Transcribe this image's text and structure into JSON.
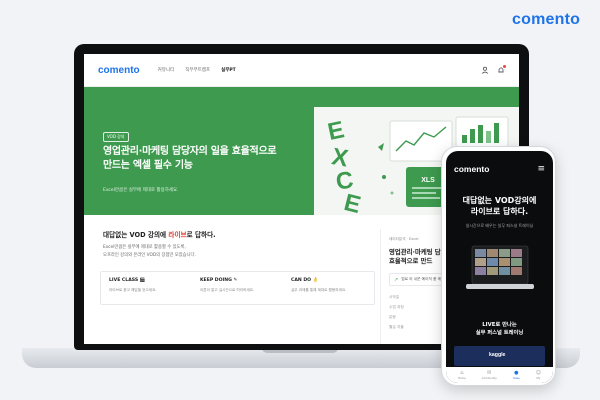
{
  "brand": "comento",
  "site": {
    "logo": "comento",
    "nav": [
      "커뮤니티",
      "직무부트캠프",
      "실무PT"
    ],
    "active_nav_index": 2,
    "icons": [
      "user-icon",
      "bell-icon"
    ]
  },
  "hero": {
    "badge": "VOD 강의",
    "title_line1": "영업관리·마케팅 담당자의 일을 효율적으로",
    "title_line2": "만드는 엑셀 필수 기능",
    "subtitle": "Excel만큼은 실무에 제대로 활용하세요.",
    "art_label": "EXCEL",
    "art_card_label": "XLS",
    "background_color": "#3d9a4e"
  },
  "intro": {
    "title_prefix": "대답없는 VOD 강의에 ",
    "title_accent": "라이브",
    "title_suffix": "로 답하다.",
    "lines": [
      "Excel만큼은 실무에 제대로 활용할 수 있도록,",
      "오프라인 강의와 온라인 VOD의 장점만 모았습니다."
    ]
  },
  "features": [
    {
      "title": "LIVE CLASS 🎬",
      "desc": "라이브로 묻고 해답을 얻으세요."
    },
    {
      "title": "KEEP DOING ✎",
      "desc": "이론이 알고 실시간으로 따라하세요."
    },
    {
      "title": "CAN DO 👌",
      "desc": "실무 과제를 통해 제대로 활용하세요."
    }
  ],
  "side_card": {
    "tag": "데이터분석 · Excel",
    "title_line1": "영업관리·마케팅 담",
    "title_line2": "효율적으로 만드",
    "pill": "업로 어 쉬운 예이직 품 메",
    "meta": [
      "시작일",
      "수업 과정",
      "분량",
      "월급 자율"
    ]
  },
  "phone": {
    "logo": "comento",
    "title_line1": "대답없는 VOD강의에",
    "title_line2": "라이브로 답하다.",
    "subtitle": "실시간으로 배우는 실무 퍼스널 트레이닝",
    "live_line1": "LIVE로 만나는",
    "live_line2": "실무 퍼스널 트레이닝",
    "banner": "kaggle",
    "tabs": [
      {
        "label": "Home",
        "icon": "home-icon"
      },
      {
        "label": "Community",
        "icon": "chat-icon"
      },
      {
        "label": "Class",
        "icon": "class-icon"
      },
      {
        "label": "My",
        "icon": "user-icon"
      }
    ],
    "active_tab_index": 2
  }
}
